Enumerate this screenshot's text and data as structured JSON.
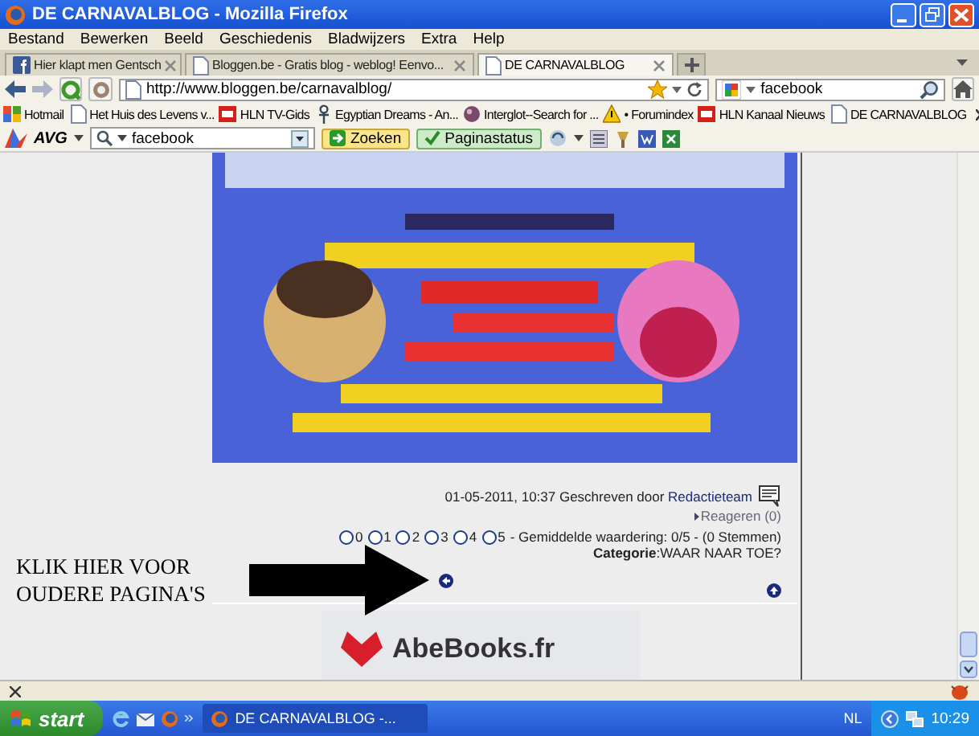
{
  "window": {
    "title": "DE CARNAVALBLOG - Mozilla Firefox"
  },
  "menu": [
    "Bestand",
    "Bewerken",
    "Beeld",
    "Geschiedenis",
    "Bladwijzers",
    "Extra",
    "Help"
  ],
  "tabs": [
    {
      "label": "Hier klapt men Gentsch",
      "selected": false
    },
    {
      "label": "Bloggen.be - Gratis blog - weblog! Eenvo...",
      "selected": false
    },
    {
      "label": "DE CARNAVALBLOG",
      "selected": true
    }
  ],
  "address": {
    "url": "http://www.bloggen.be/carnavalblog/"
  },
  "search": {
    "value": "facebook"
  },
  "bookmarks": [
    "Hotmail",
    "Het Huis des Levens v...",
    "HLN TV-Gids",
    "Egyptian Dreams - An...",
    "Interglot--Search for ...",
    "• Forumindex",
    "HLN Kanaal Nieuws",
    "DE CARNAVALBLOG"
  ],
  "avg_toolbar": {
    "brand": "AVG",
    "search_value": "facebook",
    "buttons": [
      "Zoeken",
      "Paginastatus"
    ]
  },
  "post": {
    "meta": "01-05-2011, 10:37 Geschreven door",
    "author": "Redactieteam",
    "comments": "Reageren (0)",
    "rating_options": [
      {
        "label": "0",
        "selected": false
      },
      {
        "label": "1",
        "selected": false
      },
      {
        "label": "2",
        "selected": false
      },
      {
        "label": "3",
        "selected": false
      },
      {
        "label": "4",
        "selected": false
      },
      {
        "label": "5",
        "selected": false
      }
    ],
    "rating_summary": "- Gemiddelde waardering: 0/5 - (0 Stemmen)",
    "category": "**Categorie**:WAAR NAAR TOE?"
  },
  "annotation": {
    "lines": [
      "KLIK HIER VOOR",
      "OUDERE PAGINA'S"
    ]
  },
  "ad": {
    "brand": "AbeBooks.fr"
  },
  "taskbar": {
    "start": "start",
    "task": "DE CARNAVALBLOG -...",
    "language": "NL",
    "time": "10:29"
  }
}
